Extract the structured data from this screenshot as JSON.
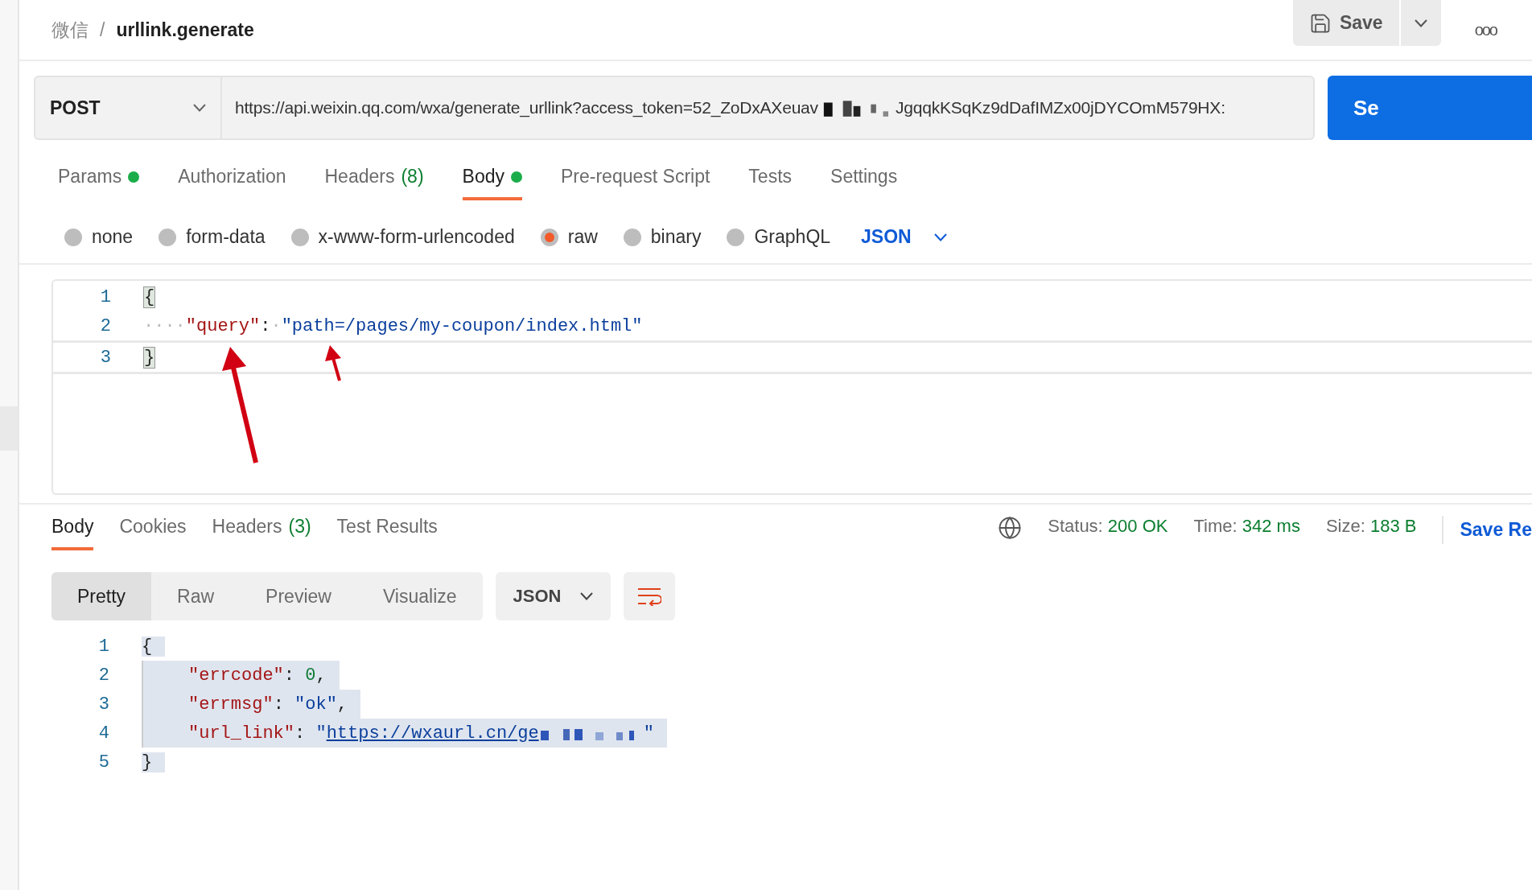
{
  "breadcrumb": {
    "parent": "微信",
    "separator": "/",
    "current": "urllink.generate"
  },
  "actions": {
    "save": "Save",
    "more": "ooo"
  },
  "request": {
    "method": "POST",
    "url_start": "https://api.weixin.qq.com/wxa/generate_urllink?access_token=52_ZoDxAXeuav",
    "url_end": "JgqqkKSqKz9dDafIMZx00jDYCOmM579HX:",
    "send": "Se"
  },
  "tabs": [
    {
      "label": "Params",
      "dot": true,
      "selected": false
    },
    {
      "label": "Authorization",
      "dot": false,
      "selected": false
    },
    {
      "label": "Headers",
      "count": "(8)",
      "dot": false,
      "selected": false
    },
    {
      "label": "Body",
      "dot": true,
      "selected": true
    },
    {
      "label": "Pre-request Script",
      "dot": false,
      "selected": false
    },
    {
      "label": "Tests",
      "dot": false,
      "selected": false
    },
    {
      "label": "Settings",
      "dot": false,
      "selected": false
    }
  ],
  "body_types": [
    {
      "label": "none",
      "selected": false
    },
    {
      "label": "form-data",
      "selected": false
    },
    {
      "label": "x-www-form-urlencoded",
      "selected": false
    },
    {
      "label": "raw",
      "selected": true
    },
    {
      "label": "binary",
      "selected": false
    },
    {
      "label": "GraphQL",
      "selected": false
    }
  ],
  "body_format": "JSON",
  "request_lines": [
    {
      "number": "1",
      "active": false,
      "tokens": [
        {
          "kind": "bracket",
          "text": "{"
        }
      ]
    },
    {
      "number": "2",
      "active": false,
      "tokens": [
        {
          "kind": "space",
          "text": "····"
        },
        {
          "kind": "key",
          "text": "\"query\""
        },
        {
          "kind": "punct",
          "text": ":"
        },
        {
          "kind": "space",
          "text": "·"
        },
        {
          "kind": "string",
          "text": "\"path=/pages/my-coupon/index.html\""
        }
      ]
    },
    {
      "number": "3",
      "active": true,
      "tokens": [
        {
          "kind": "bracket",
          "text": "}"
        }
      ]
    }
  ],
  "response_tabs": [
    {
      "label": "Body",
      "selected": true
    },
    {
      "label": "Cookies",
      "selected": false
    },
    {
      "label": "Headers",
      "count": "(3)",
      "selected": false
    },
    {
      "label": "Test Results",
      "selected": false
    }
  ],
  "status": [
    {
      "label": "Status:",
      "value": "200 OK"
    },
    {
      "label": "Time:",
      "value": "342 ms"
    },
    {
      "label": "Size:",
      "value": "183 B"
    }
  ],
  "save_response": "Save Re",
  "views": [
    {
      "label": "Pretty",
      "selected": true
    },
    {
      "label": "Raw",
      "selected": false
    },
    {
      "label": "Preview",
      "selected": false
    },
    {
      "label": "Visualize",
      "selected": false
    }
  ],
  "response_format": "JSON",
  "response_lines": [
    {
      "number": "1",
      "selected": true,
      "tokens": [
        {
          "kind": "punct",
          "text": "{"
        }
      ]
    },
    {
      "number": "2",
      "selected": true,
      "tokens": [
        {
          "kind": "indent"
        },
        {
          "kind": "key",
          "text": "\"errcode\""
        },
        {
          "kind": "punct",
          "text": ": "
        },
        {
          "kind": "number",
          "text": "0"
        },
        {
          "kind": "punct",
          "text": ","
        }
      ]
    },
    {
      "number": "3",
      "selected": true,
      "tokens": [
        {
          "kind": "indent"
        },
        {
          "kind": "key",
          "text": "\"errmsg\""
        },
        {
          "kind": "punct",
          "text": ": "
        },
        {
          "kind": "string",
          "text": "\"ok\""
        },
        {
          "kind": "punct",
          "text": ","
        }
      ]
    },
    {
      "number": "4",
      "selected": true,
      "tokens": [
        {
          "kind": "indent"
        },
        {
          "kind": "key",
          "text": "\"url_link\""
        },
        {
          "kind": "punct",
          "text": ": "
        },
        {
          "kind": "string",
          "text": "\""
        },
        {
          "kind": "link",
          "text": "https://wxaurl.cn/ge"
        },
        {
          "kind": "redacted"
        },
        {
          "kind": "string",
          "text": "\""
        }
      ]
    },
    {
      "number": "5",
      "selected": true,
      "tokens": [
        {
          "kind": "punct",
          "text": "}"
        }
      ]
    }
  ]
}
